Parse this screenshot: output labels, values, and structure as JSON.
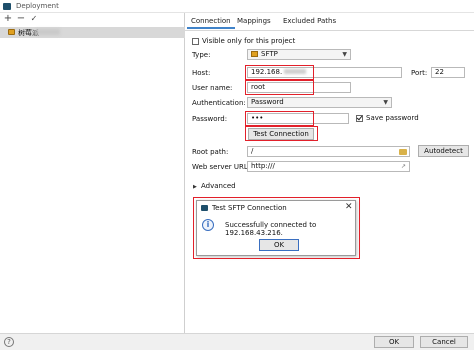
{
  "window": {
    "title": "Deployment"
  },
  "left_panel": {
    "toolbar": {
      "add": "+",
      "remove": "−",
      "apply": "✓"
    },
    "server_name": "树莓派"
  },
  "tabs": [
    "Connection",
    "Mappings",
    "Excluded Paths"
  ],
  "connection": {
    "visible_only_label": "Visible only for this project",
    "visible_only_checked": false,
    "type_label": "Type:",
    "type_value": "SFTP",
    "host_label": "Host:",
    "host_value": "192.168.",
    "port_label": "Port:",
    "port_value": "22",
    "username_label": "User name:",
    "username_value": "root",
    "auth_label": "Authentication:",
    "auth_value": "Password",
    "password_label": "Password:",
    "password_value": "•••",
    "save_password_label": "Save password",
    "save_password_checked": true,
    "test_button": "Test Connection",
    "root_path_label": "Root path:",
    "root_path_value": "/",
    "autodetect_button": "Autodetect",
    "web_url_label": "Web server URL:",
    "web_url_value": "http:///",
    "advanced_label": "Advanced"
  },
  "dialog": {
    "title": "Test SFTP Connection",
    "message": "Successfully connected to 192.168.43.216.",
    "ok_button": "OK"
  },
  "footer": {
    "help": "?",
    "ok_button": "OK",
    "cancel_button": "Cancel"
  },
  "colors": {
    "highlight_red": "#e2202a",
    "accent_tab": "#4083c9"
  }
}
